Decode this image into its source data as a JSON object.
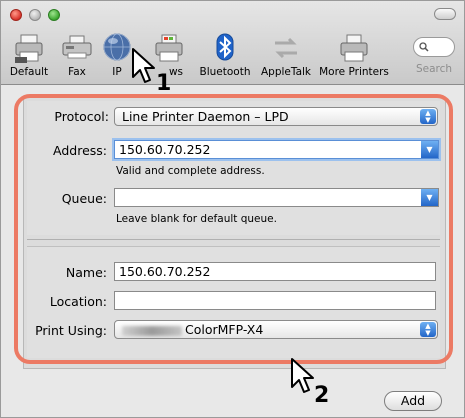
{
  "toolbar": {
    "items": [
      {
        "label": "Default",
        "icon": "printer-icon"
      },
      {
        "label": "Fax",
        "icon": "fax-icon"
      },
      {
        "label": "IP",
        "icon": "globe-icon"
      },
      {
        "label": "ws",
        "icon": "windows-printer-icon"
      },
      {
        "label": "Bluetooth",
        "icon": "bluetooth-icon"
      },
      {
        "label": "AppleTalk",
        "icon": "appletalk-icon"
      },
      {
        "label": "More Printers",
        "icon": "more-printers-icon"
      }
    ],
    "search_label": "Search"
  },
  "form": {
    "protocol_label": "Protocol:",
    "protocol_value": "Line Printer Daemon – LPD",
    "address_label": "Address:",
    "address_value": "150.60.70.252",
    "address_hint": "Valid and complete address.",
    "queue_label": "Queue:",
    "queue_value": "",
    "queue_hint": "Leave blank for default queue.",
    "name_label": "Name:",
    "name_value": "150.60.70.252",
    "location_label": "Location:",
    "location_value": "",
    "print_using_label": "Print Using:",
    "print_using_value": "ColorMFP-X4"
  },
  "add_button": "Add",
  "callouts": {
    "one": "1",
    "two": "2"
  },
  "colors": {
    "highlight": "#ec7a64",
    "accent": "#2366c8"
  }
}
